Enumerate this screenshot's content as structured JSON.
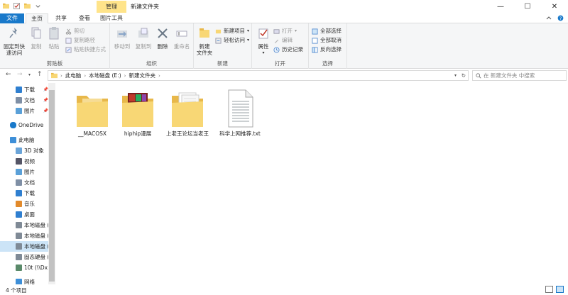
{
  "window": {
    "title": "新建文件夹",
    "context_tab_head": "管理",
    "controls": {
      "minimize": "—",
      "maximize": "☐",
      "close": "✕"
    }
  },
  "tabs": {
    "file": "文件",
    "home": "主页",
    "share": "共享",
    "view": "查看",
    "picture_tools": "图片工具"
  },
  "ribbon": {
    "clipboard": {
      "label": "剪贴板",
      "pin_quick": "固定到快",
      "pin_quick2": "速访问",
      "copy": "复制",
      "paste": "粘贴",
      "cut": "剪切",
      "copy_path": "复制路径",
      "paste_shortcut": "粘贴快捷方式"
    },
    "organize": {
      "label": "组织",
      "move_to": "移动到",
      "copy_to": "复制到",
      "delete": "删除",
      "rename": "重命名"
    },
    "new": {
      "label": "新建",
      "new_folder": "新建",
      "new_folder2": "文件夹",
      "new_item": "新建项目",
      "easy_access": "轻松访问"
    },
    "open": {
      "label": "打开",
      "properties": "属性",
      "open": "打开",
      "edit": "编辑",
      "history": "历史记录"
    },
    "select": {
      "label": "选择",
      "select_all": "全部选择",
      "select_none": "全部取消",
      "invert": "反向选择"
    }
  },
  "address": {
    "crumbs": [
      "此电脑",
      "本地磁盘 (E:)",
      "新建文件夹"
    ],
    "search_placeholder": "在 新建文件夹 中搜索"
  },
  "sidebar": {
    "items": [
      {
        "label": "下载",
        "icon": "download-icon",
        "pinned": true
      },
      {
        "label": "文档",
        "icon": "document-icon",
        "pinned": true
      },
      {
        "label": "图片",
        "icon": "picture-icon",
        "pinned": true
      },
      {
        "label": "OneDrive",
        "icon": "cloud-icon"
      },
      {
        "label": "此电脑",
        "icon": "computer-icon"
      },
      {
        "label": "3D 对象",
        "icon": "cube-icon"
      },
      {
        "label": "视频",
        "icon": "video-icon"
      },
      {
        "label": "图片",
        "icon": "picture-icon"
      },
      {
        "label": "文档",
        "icon": "document-icon"
      },
      {
        "label": "下载",
        "icon": "download-icon"
      },
      {
        "label": "音乐",
        "icon": "music-icon"
      },
      {
        "label": "桌面",
        "icon": "desktop-icon"
      },
      {
        "label": "本地磁盘 (",
        "icon": "drive-icon"
      },
      {
        "label": "本地磁盘 (",
        "icon": "drive-icon"
      },
      {
        "label": "本地磁盘 (",
        "icon": "drive-icon",
        "selected": true
      },
      {
        "label": "固态硬盘 (",
        "icon": "drive-icon"
      },
      {
        "label": "10t (\\\\Dx",
        "icon": "network-drive-icon"
      },
      {
        "label": "网络",
        "icon": "network-icon"
      }
    ]
  },
  "files": [
    {
      "name": "__MACOSX",
      "type": "folder"
    },
    {
      "name": "hiphip漫展",
      "type": "folder-images"
    },
    {
      "name": "上老王论坛当老王",
      "type": "folder-docs"
    },
    {
      "name": "科学上网推荐.txt",
      "type": "text"
    }
  ],
  "status": {
    "count": "4 个项目"
  },
  "colors": {
    "accent": "#1979ca",
    "folder": "#f8d775",
    "selected": "#cce4f7",
    "context_tab": "#ffe48a"
  }
}
